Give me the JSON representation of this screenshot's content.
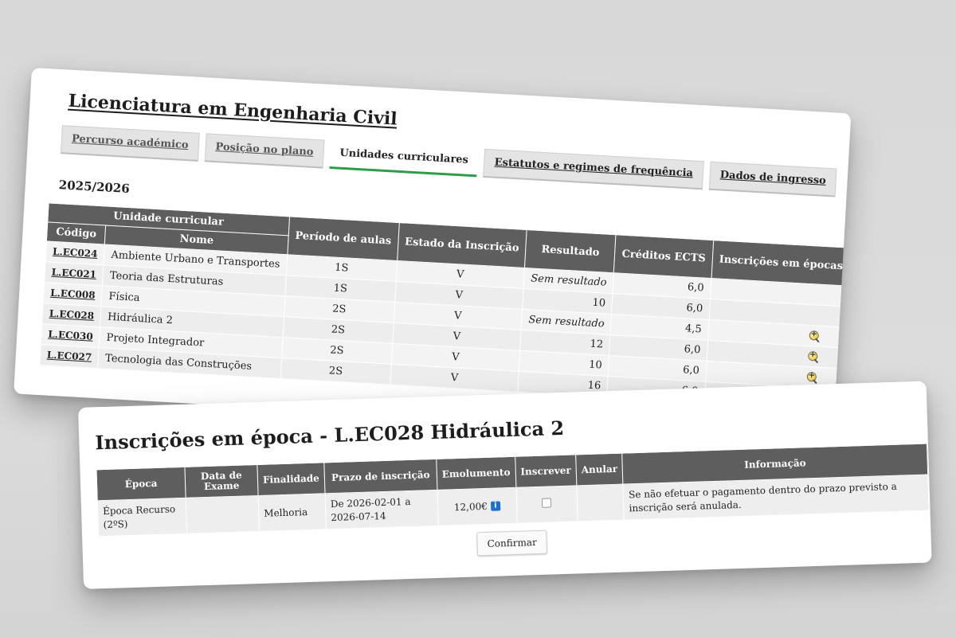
{
  "course": {
    "title": "Licenciatura em Engenharia Civil",
    "tabs": [
      {
        "label": "Percurso académico"
      },
      {
        "label": "Posição no plano"
      },
      {
        "label": "Unidades curriculares"
      },
      {
        "label": "Estatutos e regimes de frequência"
      },
      {
        "label": "Dados de ingresso"
      }
    ],
    "active_tab": "Unidades curriculares",
    "year": "2025/2026"
  },
  "uc_table": {
    "group_header": "Unidade curricular",
    "headers": {
      "code": "Código",
      "name": "Nome",
      "period": "Período de aulas",
      "state": "Estado da Inscrição",
      "result": "Resultado",
      "ects": "Créditos ECTS",
      "enrollments": "Inscrições em épocas de avaliação"
    },
    "rows": [
      {
        "code": "L.EC024",
        "name": "Ambiente Urbano e Transportes",
        "period": "1S",
        "state": "V",
        "result": "Sem resultado",
        "ects": "6,0",
        "icon": false
      },
      {
        "code": "L.EC021",
        "name": "Teoria das Estruturas",
        "period": "1S",
        "state": "V",
        "result": "10",
        "ects": "6,0",
        "icon": false
      },
      {
        "code": "L.EC008",
        "name": "Física",
        "period": "2S",
        "state": "V",
        "result": "Sem resultado",
        "ects": "4,5",
        "icon": true
      },
      {
        "code": "L.EC028",
        "name": "Hidráulica 2",
        "period": "2S",
        "state": "V",
        "result": "12",
        "ects": "6,0",
        "icon": true
      },
      {
        "code": "L.EC030",
        "name": "Projeto Integrador",
        "period": "2S",
        "state": "V",
        "result": "10",
        "ects": "6,0",
        "icon": true
      },
      {
        "code": "L.EC027",
        "name": "Tecnologia das Construções",
        "period": "2S",
        "state": "V",
        "result": "16",
        "ects": "6,0",
        "icon": true
      }
    ],
    "icon_name": "magnifier-plus-icon"
  },
  "modal": {
    "title": "Inscrições em época - L.EC028 Hidráulica 2",
    "headers": {
      "epoca": "Época",
      "data_exame": "Data de Exame",
      "finalidade": "Finalidade",
      "prazo": "Prazo de inscrição",
      "emolumento": "Emolumento",
      "inscrever": "Inscrever",
      "anular": "Anular",
      "informacao": "Informação"
    },
    "row": {
      "epoca": "Época Recurso (2ºS)",
      "data_exame": "",
      "finalidade": "Melhoria",
      "prazo": "De 2026-02-01 a 2026-07-14",
      "emolumento": "12,00€",
      "inscrever_checked": false,
      "anular": "",
      "informacao": "Se não efetuar o pagamento dentro do prazo previsto a inscrição será anulada."
    },
    "confirm_label": "Confirmar",
    "info_icon": "info-icon"
  },
  "colors": {
    "header_bg": "#5e5e5e",
    "active_tab_accent": "#2e9d4a",
    "info_blue": "#1e6fd1"
  }
}
